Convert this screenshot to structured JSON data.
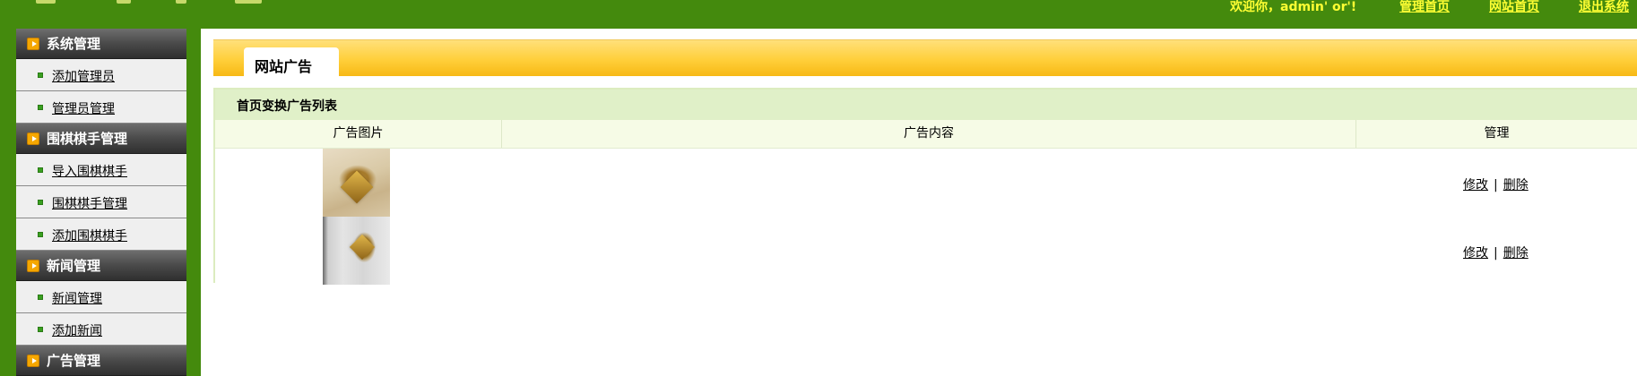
{
  "header": {
    "welcome": "欢迎你，admin' or'!",
    "links": [
      {
        "label": "管理首页"
      },
      {
        "label": "网站首页"
      },
      {
        "label": "退出系统"
      }
    ]
  },
  "sidebar": {
    "groups": [
      {
        "title": "系统管理",
        "items": [
          "添加管理员",
          "管理员管理"
        ]
      },
      {
        "title": "围棋棋手管理",
        "items": [
          "导入围棋棋手",
          "围棋棋手管理",
          "添加围棋棋手"
        ]
      },
      {
        "title": "新闻管理",
        "items": [
          "新闻管理",
          "添加新闻"
        ]
      },
      {
        "title": "广告管理",
        "items": []
      }
    ]
  },
  "main": {
    "tab_label": "网站广告",
    "list_title": "首页变换广告列表",
    "columns": [
      "广告图片",
      "广告内容",
      "管理"
    ],
    "rows": [
      {
        "image": "ad-image-1",
        "content": "",
        "edit_label": "修改",
        "delete_label": "删除",
        "separator": "|"
      },
      {
        "image": "ad-image-2",
        "content": "",
        "edit_label": "修改",
        "delete_label": "删除",
        "separator": "|"
      }
    ]
  },
  "colors": {
    "brand_green": "#448a0d",
    "header_link": "#ffff33",
    "tab_bar": "#ffcf3a",
    "list_title_bg": "#e0f0c8"
  }
}
